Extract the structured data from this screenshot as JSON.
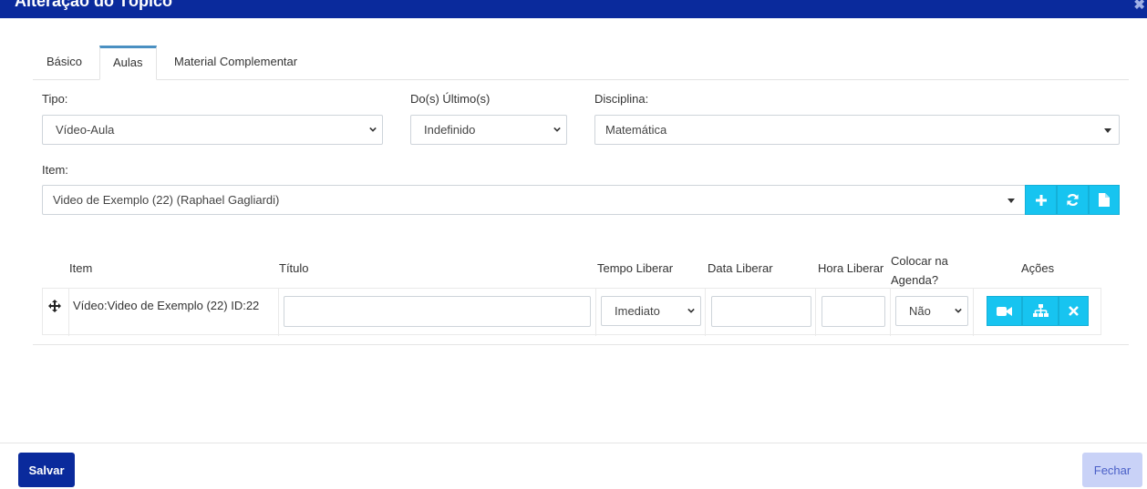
{
  "dialog": {
    "title": "Alteração do Tópico",
    "close_glyph": "✖"
  },
  "tabs": [
    {
      "label": "Básico",
      "active": false
    },
    {
      "label": "Aulas",
      "active": true
    },
    {
      "label": "Material Complementar",
      "active": false
    }
  ],
  "form": {
    "tipo": {
      "label": "Tipo:",
      "value": "Vídeo-Aula"
    },
    "ultimos": {
      "label": "Do(s) Último(s)",
      "value": "Indefinido"
    },
    "disciplina": {
      "label": "Disciplina:",
      "value": "Matemática"
    },
    "item": {
      "label": "Item:",
      "value": "Video de Exemplo (22) (Raphael Gagliardi)"
    },
    "item_actions": [
      "plus-icon",
      "refresh-icon",
      "file-icon"
    ]
  },
  "table": {
    "headers": {
      "item": "Item",
      "titulo": "Título",
      "tempo": "Tempo Liberar",
      "data": "Data Liberar",
      "hora": "Hora Liberar",
      "agenda_line1": "Colocar na",
      "agenda_line2": "Agenda?",
      "acoes": "Ações"
    },
    "rows": [
      {
        "item": "Vídeo:Video de Exemplo (22) ID:22",
        "titulo": "",
        "tempo": "Imediato",
        "data": "",
        "hora": "",
        "agenda": "Não",
        "actions": [
          "video-camera-icon",
          "sitemap-icon",
          "close-icon"
        ]
      }
    ]
  },
  "footer": {
    "save_label": "Salvar",
    "close_label": "Fechar"
  },
  "colors": {
    "primary": "#0a2a9c",
    "accent": "#17c4f0",
    "secondary_button": "#c9d2f7"
  }
}
